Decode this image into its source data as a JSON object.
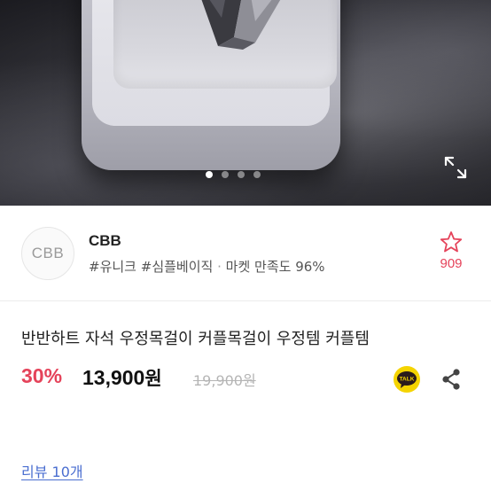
{
  "product_image": {
    "carousel": {
      "total": 4,
      "active_index": 0
    },
    "expand_icon": "expand-icon"
  },
  "shop": {
    "logo_text": "CBB",
    "name": "CBB",
    "tag1": "#유니크",
    "tag2": "#심플베이직",
    "separator": "·",
    "satisfaction": "마켓 만족도 96%",
    "favorite_icon": "star-outline-icon",
    "favorite_count": "909"
  },
  "product": {
    "title": "반반하트 자석 우정목걸이 커플목걸이 우정템 커플템",
    "discount": "30%",
    "price_number": "13,900",
    "price_unit": "원",
    "original_price": "19,900원",
    "kakao_label": "TALK",
    "share_icon": "share-icon"
  },
  "reviews": {
    "link_label": "리뷰 10개"
  },
  "colors": {
    "accent": "#e5435a",
    "link": "#4a6ed0",
    "kakao": "#2b1b1b"
  }
}
